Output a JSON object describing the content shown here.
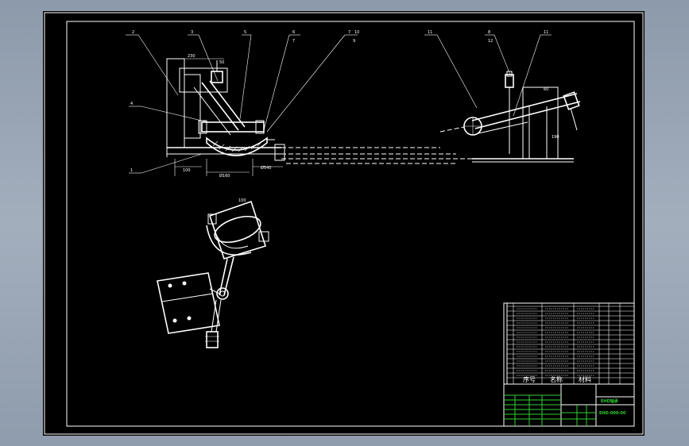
{
  "drawing": {
    "front_view": {
      "leaders": [
        "2",
        "3",
        "5",
        "6",
        "7",
        "10"
      ],
      "sub_labels": [
        "7",
        "9"
      ],
      "side_leaders": [
        "4",
        "1"
      ],
      "dims": [
        "230",
        "50",
        "100",
        "Ø160",
        "Ø540"
      ]
    },
    "side_view": {
      "leaders": [
        "11",
        "8",
        "11"
      ],
      "sub_labels": [
        "12"
      ],
      "dims": [
        "60",
        "190"
      ]
    },
    "bottom_view": {
      "dims": [
        "100"
      ]
    },
    "parts_list": {
      "header": [
        "序号",
        "名称",
        "材料"
      ],
      "row_count": 15
    },
    "title_block": {
      "title": "EHD轴承",
      "code": "EHD-000-00"
    }
  },
  "colors": {
    "background": "#000000",
    "frame": "#ffffff",
    "title_block_text": "#2fd02f",
    "outer": "#98a4b5"
  }
}
